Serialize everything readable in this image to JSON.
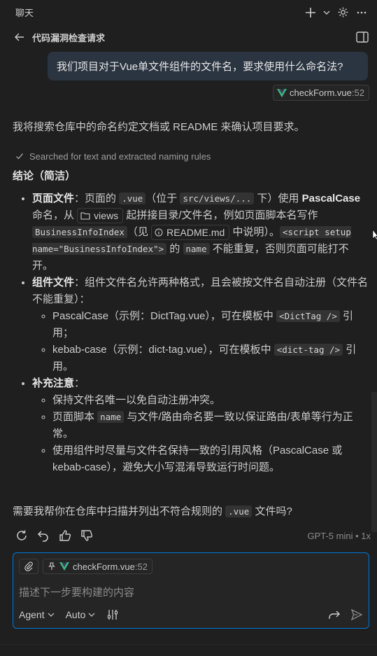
{
  "header": {
    "title": "聊天",
    "subtitle": "代码漏洞检查请求"
  },
  "user_message": {
    "text": "我们项目对于Vue单文件组件的文件名，要求使用什么命名法?",
    "reference_file": "checkForm.vue",
    "reference_line": ":52"
  },
  "assistant": {
    "intro": "我将搜索仓库中的命名约定文档或 README 来确认项目要求。",
    "progress": "Searched for text and extracted naming rules",
    "heading": "结论（简洁）",
    "b1": {
      "label": "页面文件",
      "t1": "：页面的 ",
      "c1": ".vue",
      "t2": "（位于 ",
      "c2": "src/views/...",
      "t3": " 下）使用 ",
      "bold": "PascalCase",
      "t4": " 命名，从 ",
      "folder": "views",
      "t5": " 起拼接目录/文件名，例如页面脚本名写作 ",
      "c3": "BusinessInfoIndex",
      "t6": "（见 ",
      "readme": "README.md",
      "t7": " 中说明）。",
      "c4": "<script setup name=\"BusinessInfoIndex\">",
      "t8": " 的 ",
      "c5": "name",
      "t9": " 不能重复，否则页面可能打不开。"
    },
    "b2": {
      "label": "组件文件",
      "text": "：组件文件名允许两种格式，且会被按文件名自动注册（文件名不能重复）：",
      "s1_a": "PascalCase（示例：DictTag.vue），可在模板中 ",
      "s1_code": "<DictTag />",
      "s1_b": " 引用；",
      "s2_a": "kebab-case（示例：dict-tag.vue），可在模板中 ",
      "s2_code": "<dict-tag />",
      "s2_b": " 引用。"
    },
    "b3": {
      "label": "补充注意",
      "colon": "：",
      "s1": "保持文件名唯一以免自动注册冲突。",
      "s2_a": "页面脚本 ",
      "s2_code": "name",
      "s2_b": " 与文件/路由命名要一致以保证路由/表单等行为正常。",
      "s3": "使用组件时尽量与文件名保持一致的引用风格（PascalCase 或 kebab-case），避免大小写混淆导致运行时问题。"
    },
    "final_a": "需要我帮你在仓库中扫描并列出不符合规则的 ",
    "final_code": ".vue",
    "final_b": " 文件吗?"
  },
  "feedback": {
    "model": "GPT-5 mini • 1x"
  },
  "input": {
    "context_file": "checkForm.vue",
    "context_line": ":52",
    "placeholder": "描述下一步要构建的内容",
    "mode": "Agent",
    "model": "Auto"
  },
  "colors": {
    "accent": "#0078d4",
    "vue_green": "#41b883",
    "vue_dark": "#35495e",
    "background": "#1f1f1f",
    "user_bubble": "#2b3541"
  }
}
